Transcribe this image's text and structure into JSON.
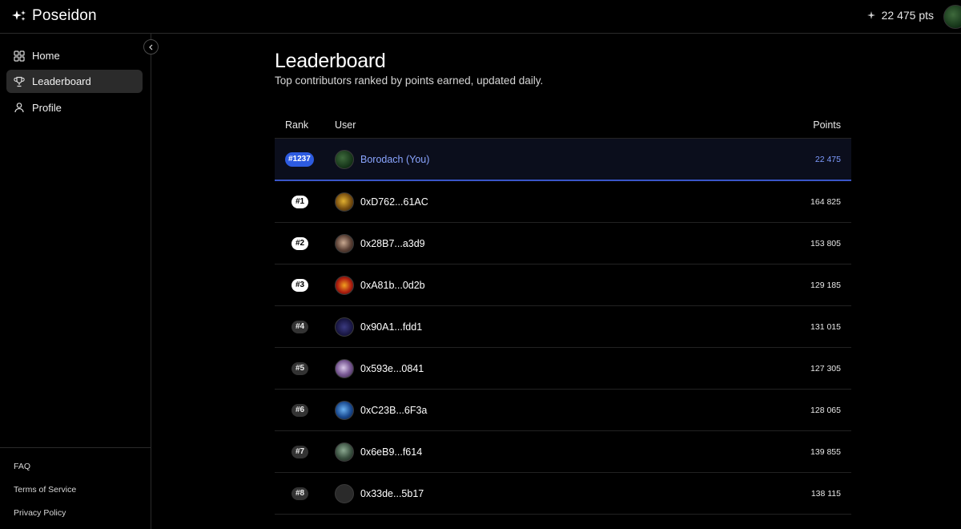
{
  "app": {
    "name": "Poseidon"
  },
  "header": {
    "points_display": "22 475 pts"
  },
  "sidebar": {
    "items": [
      {
        "label": "Home",
        "icon": "grid-icon",
        "active": false
      },
      {
        "label": "Leaderboard",
        "icon": "trophy-icon",
        "active": true
      },
      {
        "label": "Profile",
        "icon": "user-icon",
        "active": false
      }
    ],
    "footer_links": [
      {
        "label": "FAQ"
      },
      {
        "label": "Terms of Service"
      },
      {
        "label": "Privacy Policy"
      }
    ]
  },
  "page": {
    "title": "Leaderboard",
    "subtitle": "Top contributors ranked by points earned, updated daily."
  },
  "table": {
    "columns": {
      "rank": "Rank",
      "user": "User",
      "points": "Points"
    },
    "current_user": {
      "rank": "#1237",
      "name": "Borodach (You)",
      "points": "22 475"
    },
    "rows": [
      {
        "rank": "#1",
        "name": "0xD762...61AC",
        "points": "164 825"
      },
      {
        "rank": "#2",
        "name": "0x28B7...a3d9",
        "points": "153 805"
      },
      {
        "rank": "#3",
        "name": "0xA81b...0d2b",
        "points": "129 185"
      },
      {
        "rank": "#4",
        "name": "0x90A1...fdd1",
        "points": "131 015"
      },
      {
        "rank": "#5",
        "name": "0x593e...0841",
        "points": "127 305"
      },
      {
        "rank": "#6",
        "name": "0xC23B...6F3a",
        "points": "128 065"
      },
      {
        "rank": "#7",
        "name": "0x6eB9...f614",
        "points": "139 855"
      },
      {
        "rank": "#8",
        "name": "0x33de...5b17",
        "points": "138 115"
      }
    ]
  },
  "colors": {
    "accent": "#2d5be0",
    "you_text": "#8aa5ff",
    "active_nav": "#2b2b2b"
  }
}
